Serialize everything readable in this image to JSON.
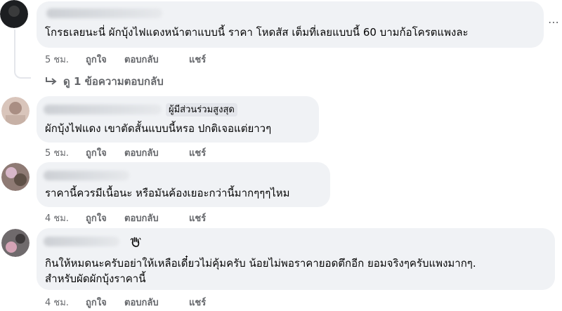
{
  "comments": [
    {
      "text": "โกรธเลยนะนี่ ผักบุ้งไฟแดงหน้าตาแบบนี้ ราคา โหดสัส เต็มที่เลยแบบนี้ 60 บามก้อโครตแพงละ",
      "time": "5 ชม.",
      "like": "ถูกใจ",
      "reply": "ตอบกลับ",
      "share": "แชร์",
      "view_replies": "ดู 1 ข้อความตอบกลับ"
    },
    {
      "badge": "ผู้มีส่วนร่วมสูงสุด",
      "text": "ผักบุ้งไฟแดง เขาตัดสั้นแบบนี้หรอ ปกติเจอแต่ยาวๆ",
      "time": "5 ชม.",
      "like": "ถูกใจ",
      "reply": "ตอบกลับ",
      "share": "แชร์"
    },
    {
      "text": "ราคานี้ควรมีเนื้อนะ หรือมันค้องเยอะกว่านี้มากๆๆๆไหม",
      "time": "4 ชม.",
      "like": "ถูกใจ",
      "reply": "ตอบกลับ",
      "share": "แชร์"
    },
    {
      "text_line1": "กินให้หมดนะครับอย่าให้เหลือเดี๋ยวไม่คุ้มครับ น้อยไม่พอราคายอดตึกอีก ยอมจริงๆครับแพงมากๆ.",
      "text_line2": "สำหรับผัดผักบุ้งราคานี้",
      "time": "4 ชม.",
      "like": "ถูกใจ",
      "reply": "ตอบกลับ",
      "share": "แชร์"
    }
  ],
  "icons": {
    "more": "more-options-icon",
    "reply_arrow": "reply-arrow-icon",
    "wave": "waving-hand-icon"
  },
  "colors": {
    "bubble": "#f0f2f5",
    "meta": "#65676b",
    "text": "#050505"
  }
}
